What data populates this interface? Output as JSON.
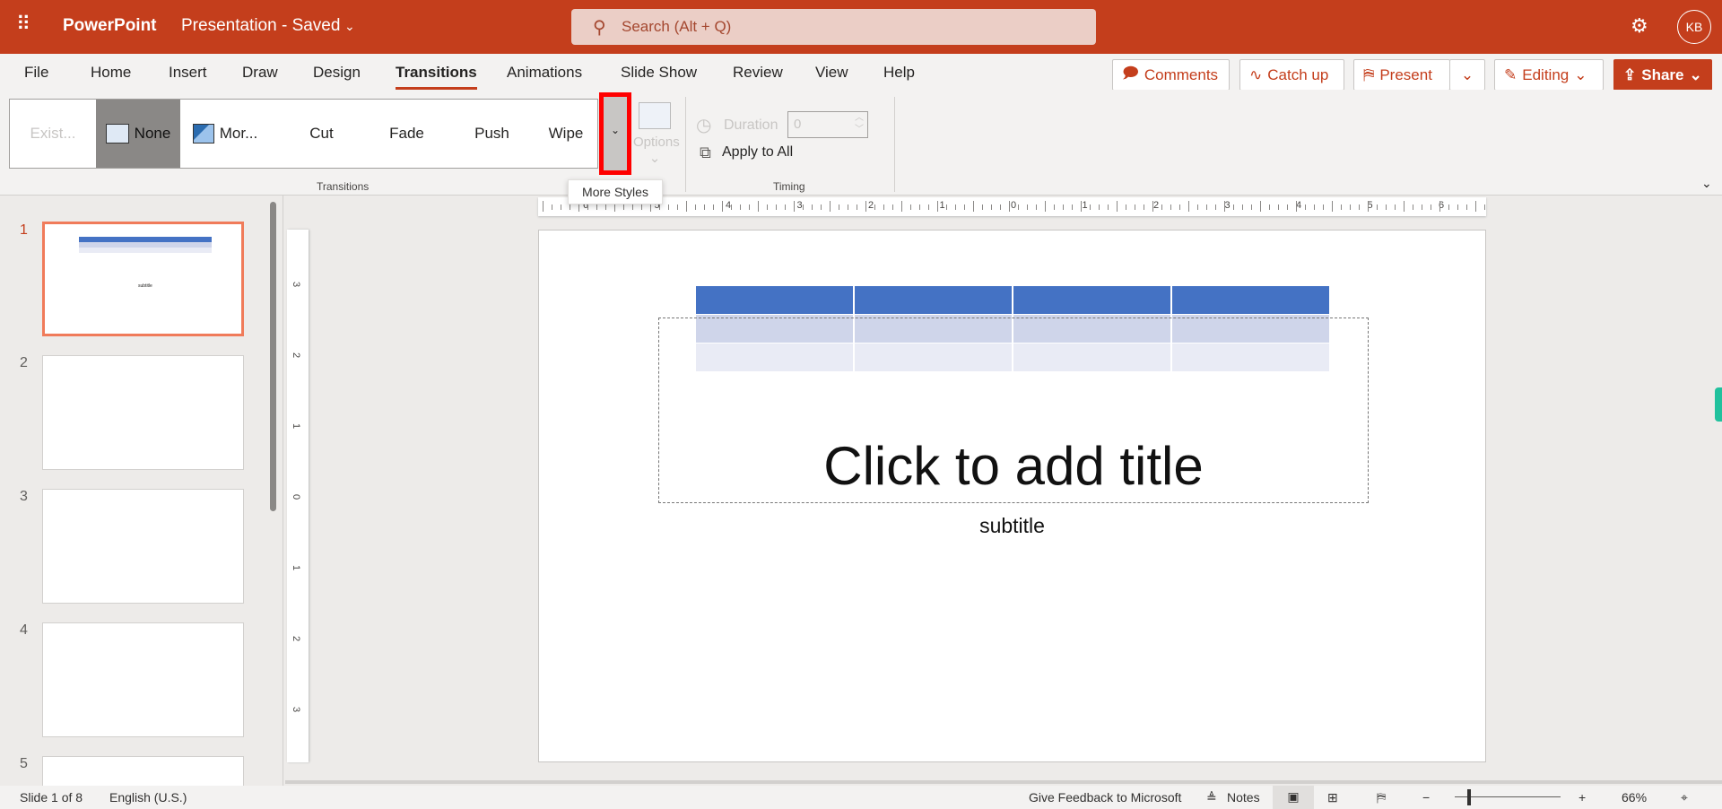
{
  "app": {
    "name": "PowerPoint",
    "doc_title": "Presentation - Saved",
    "search_placeholder": "Search (Alt + Q)",
    "avatar": "KB"
  },
  "tabs": [
    {
      "label": "File"
    },
    {
      "label": "Home"
    },
    {
      "label": "Insert"
    },
    {
      "label": "Draw"
    },
    {
      "label": "Design"
    },
    {
      "label": "Transitions",
      "active": true
    },
    {
      "label": "Animations"
    },
    {
      "label": "Slide Show"
    },
    {
      "label": "Review"
    },
    {
      "label": "View"
    },
    {
      "label": "Help"
    }
  ],
  "header_buttons": {
    "comments": "Comments",
    "catch_up": "Catch up",
    "present": "Present",
    "editing": "Editing",
    "share": "Share"
  },
  "ribbon": {
    "gallery": [
      {
        "label": "Exist...",
        "disabled": true
      },
      {
        "label": "None",
        "selected": true
      },
      {
        "label": "Mor..."
      },
      {
        "label": "Cut"
      },
      {
        "label": "Fade"
      },
      {
        "label": "Push"
      },
      {
        "label": "Wipe"
      }
    ],
    "options_label": "Options",
    "group_transitions": "Transitions",
    "duration_label": "Duration",
    "duration_value": "0",
    "apply_all": "Apply to All",
    "group_timing": "Timing",
    "tooltip": "More Styles"
  },
  "ruler_h": [
    "6",
    "5",
    "4",
    "3",
    "2",
    "1",
    "0",
    "1",
    "2",
    "3",
    "4",
    "5",
    "6"
  ],
  "ruler_v": [
    "3",
    "2",
    "1",
    "0",
    "1",
    "2",
    "3"
  ],
  "slides": [
    {
      "num": "1"
    },
    {
      "num": "2"
    },
    {
      "num": "3"
    },
    {
      "num": "4"
    },
    {
      "num": "5"
    }
  ],
  "slide": {
    "title_placeholder": "Click to add title",
    "subtitle": "subtitle",
    "thumb_subtitle": "subtitle"
  },
  "status": {
    "slide": "Slide 1 of 8",
    "language": "English (U.S.)",
    "feedback": "Give Feedback to Microsoft",
    "notes": "Notes",
    "zoom": "66%"
  },
  "colors": {
    "brand": "#c43e1c",
    "table_header": "#4472c4",
    "table_row1": "#cfd5ea",
    "table_row2": "#e9ebf5",
    "highlight": "#ff0000"
  }
}
